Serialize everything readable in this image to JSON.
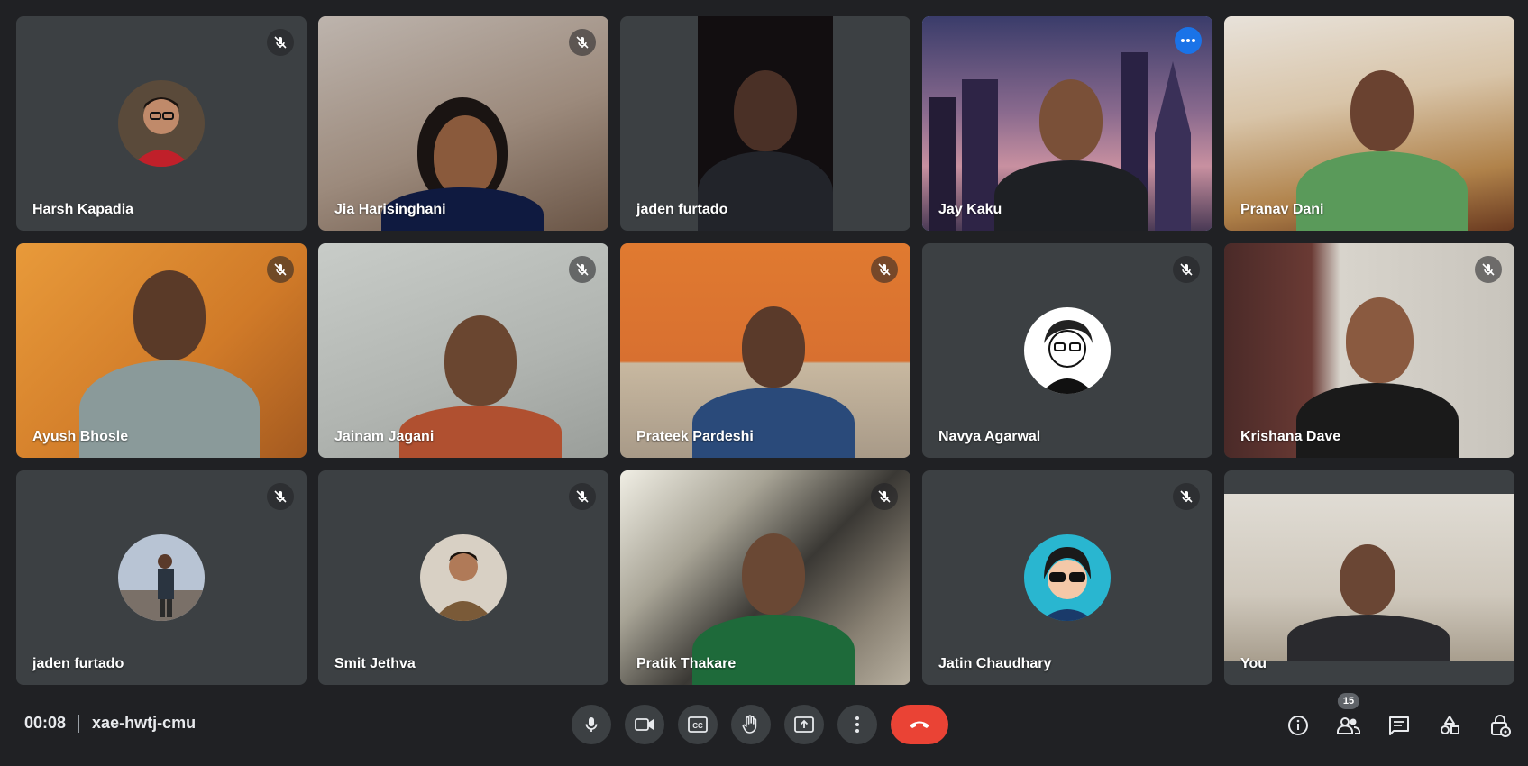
{
  "participants": [
    {
      "name": "Harsh Kapadia"
    },
    {
      "name": "Jia Harisinghani"
    },
    {
      "name": "jaden furtado"
    },
    {
      "name": "Jay Kaku"
    },
    {
      "name": "Pranav Dani"
    },
    {
      "name": "Ayush Bhosle"
    },
    {
      "name": "Jainam Jagani"
    },
    {
      "name": "Prateek Pardeshi"
    },
    {
      "name": "Navya Agarwal"
    },
    {
      "name": "Krishana Dave"
    },
    {
      "name": "jaden furtado"
    },
    {
      "name": "Smit Jethva"
    },
    {
      "name": "Pratik Thakare"
    },
    {
      "name": "Jatin Chaudhary"
    },
    {
      "name": "You"
    }
  ],
  "meeting": {
    "time": "00:08",
    "code": "xae-hwtj-cmu",
    "people_count": "15"
  },
  "icons": {
    "mic": "mic-icon",
    "camera": "camera-icon",
    "captions": "captions-icon",
    "raise_hand": "raise-hand-icon",
    "present": "present-icon",
    "more": "more-vert-icon",
    "end_call": "end-call-icon",
    "info": "info-icon",
    "people": "people-icon",
    "chat": "chat-icon",
    "activities": "activities-icon",
    "host_controls": "host-controls-icon"
  },
  "colors": {
    "background": "#202124",
    "tile": "#3c4043",
    "end_call": "#ea4335",
    "active_border": "#8ab4f8",
    "more_button": "#1a73e8"
  }
}
